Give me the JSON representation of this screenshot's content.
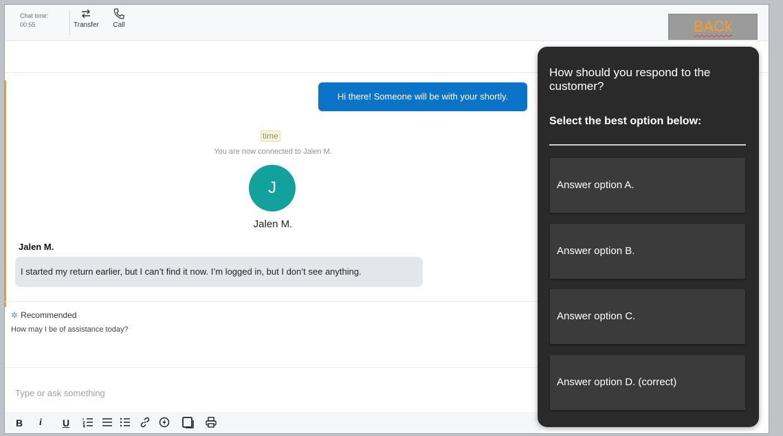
{
  "header": {
    "chat_time_label": "Chat time:",
    "chat_time_value": "00:55",
    "transfer_label": "Transfer",
    "call_label": "Call",
    "back_label": "BACk"
  },
  "chat": {
    "agent_message": "Hi there! Someone will be with your shortly.",
    "time_chip": "time",
    "connected_text": "You are now connected to Jalen M.",
    "avatar_initial": "J",
    "avatar_name": "Jalen M.",
    "sender_name": "Jalen M.",
    "customer_message": "I started my return earlier, but I can’t find it now. I’m logged in, but I don’t see anything."
  },
  "recommended": {
    "label": "Recommended",
    "text": "How may I be of assistance today?"
  },
  "composer": {
    "placeholder": "Type or ask something"
  },
  "format_toolbar": {
    "bold": "B",
    "italic": "i",
    "underline": "U"
  },
  "panel": {
    "question": "How should you respond to the customer?",
    "instruction": "Select the best option below:",
    "options": [
      "Answer option A.",
      "Answer option B.",
      "Answer option C.",
      "Answer option D. (correct)"
    ]
  },
  "colors": {
    "agent_bubble": "#0b73c8",
    "avatar": "#12a29b",
    "panel_bg": "#2a2a2a",
    "option_bg": "#3b3b3b",
    "back_text": "#ff9c1a"
  }
}
